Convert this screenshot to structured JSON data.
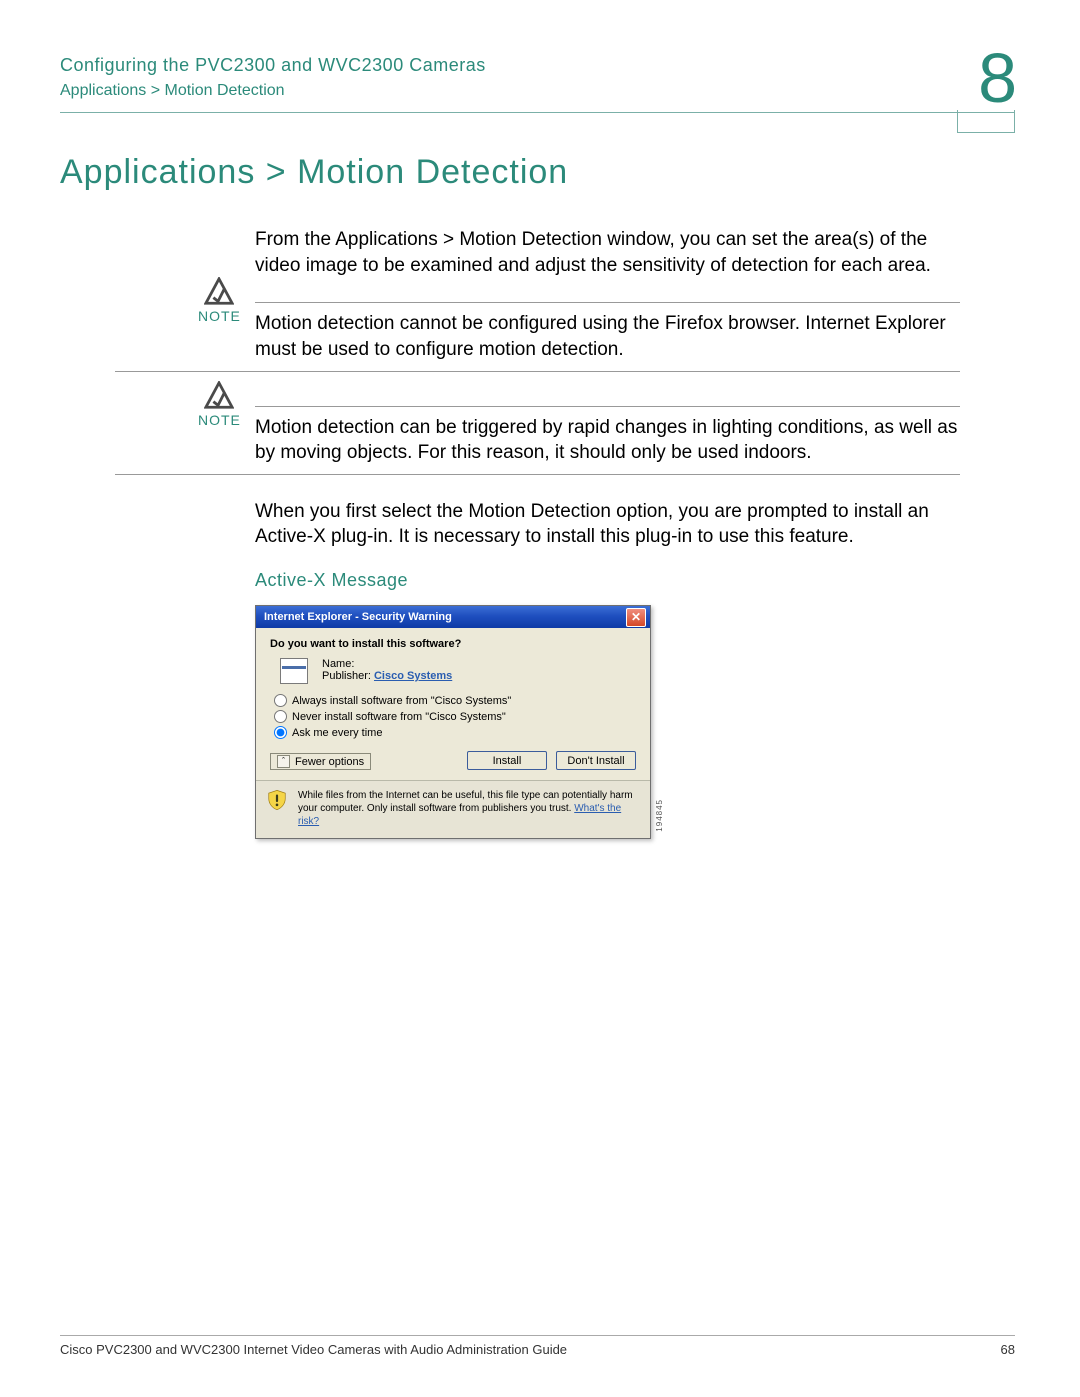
{
  "header": {
    "chapter_title": "Configuring the PVC2300 and WVC2300 Cameras",
    "breadcrumb": "Applications > Motion Detection",
    "chapter_number": "8"
  },
  "section": {
    "heading": "Applications > Motion Detection",
    "intro": "From the Applications > Motion Detection window, you can set the area(s) of the video image to be examined and adjust the sensitivity of detection for each area."
  },
  "notes": [
    {
      "label": "NOTE",
      "text": "Motion detection cannot be configured using the Firefox browser. Internet Explorer must be used to configure motion detection."
    },
    {
      "label": "NOTE",
      "text": "Motion detection can be triggered by rapid changes in lighting conditions, as well as by moving objects. For this reason, it should only be used indoors."
    }
  ],
  "body2": "When you first select the Motion Detection option, you are prompted to install an Active-X plug-in. It is necessary to install this plug-in to use this feature.",
  "sub_heading": "Active-X Message",
  "dialog": {
    "title": "Internet Explorer - Security Warning",
    "question": "Do you want to install this software?",
    "name_label": "Name:",
    "publisher_label": "Publisher:",
    "publisher_value": "Cisco Systems",
    "options": [
      "Always install software from \"Cisco Systems\"",
      "Never install software from \"Cisco Systems\"",
      "Ask me every time"
    ],
    "fewer_label": "Fewer options",
    "install_label": "Install",
    "dont_install_label": "Don't Install",
    "warning_text_1": "While files from the Internet can be useful, this file type can potentially harm your computer. Only install software from publishers you trust. ",
    "warning_link": "What's the risk?",
    "sidenum": "194845"
  },
  "footer": {
    "doc_title": "Cisco PVC2300 and WVC2300 Internet Video Cameras with Audio Administration Guide",
    "page_number": "68"
  }
}
